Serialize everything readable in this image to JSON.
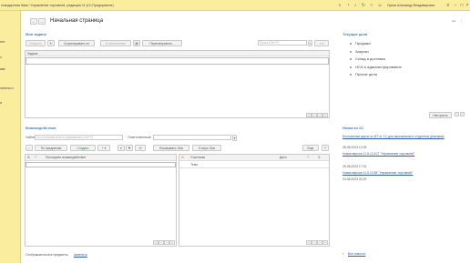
{
  "titlebar": {
    "title": "стандартная база / Управление торговлей, редакция 11  (1С:Предприятие)",
    "user": "Орлов Александр Владимирович"
  },
  "sidebar": {
    "items": [
      "ент",
      "з",
      "ква",
      "льтаты и",
      "и"
    ]
  },
  "header": {
    "back_label": "←",
    "forward_label": "→",
    "title": "Начальная страница"
  },
  "tasks": {
    "section_title": "Мои задачи",
    "toolbar": {
      "open": "Открыть",
      "group": "Сгруппировать по",
      "execute": "К исполнению",
      "redirect": "Перенаправить..."
    },
    "search_placeholder": "Поиск (Ctrl+F)",
    "column_task": "Задача"
  },
  "current_affairs": {
    "section_title": "Текущие дела",
    "items": [
      "Продажи",
      "Закупки",
      "Склад и доставка",
      "НСИ и администрирование",
      "Прочие дела"
    ],
    "settings_label": "Настроить"
  },
  "interactions": {
    "section_title": "Взаимодействия",
    "find_label": "Найти",
    "find_placeholder": "по контактам или по реквизитам (Ctrl+F)",
    "responsible_label": "Ответственный",
    "toolbar": {
      "by_subjects": "По предметам",
      "create": "Создать",
      "show": "Показывать: Все",
      "status": "Статус: Все",
      "more": "Еще",
      "help": "?"
    },
    "left_column": "Последнее взаимодействие",
    "right_columns": {
      "participant": "Участники",
      "date": "Дата",
      "topic": "Тема"
    },
    "footer_text": "Отображаются все предметы,",
    "footer_link": "изменить"
  },
  "news": {
    "section_title": "Новости 1С",
    "items": [
      {
        "title": "Бесплатные курсы по ИТ от 1С  для школьников и студентов (реклама)",
        "date": ""
      },
      {
        "date": "28.08.2023 13:39",
        "title": "Новая версия 11.5.12.107 \"Управление торговлей\""
      },
      {
        "date": "25.08.2023 17:02",
        "title": "Новая версия 11.5.13.58 \"Управление торговлей\""
      },
      {
        "date": "24.08.2023 20:29",
        "title": ""
      }
    ],
    "all_news_label": "Все новости"
  },
  "colors": {
    "accent_yellow": "#fbed9e",
    "section_title": "#4a7fb5",
    "link": "#2a5db0"
  }
}
